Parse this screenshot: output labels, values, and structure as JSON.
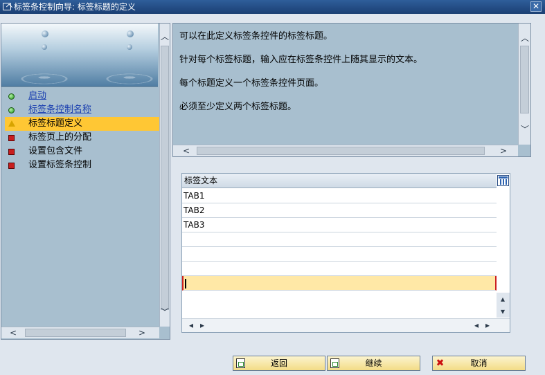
{
  "window": {
    "title": "标签条控制向导: 标签标题的定义",
    "close_glyph": "✕"
  },
  "steps": [
    {
      "label": "启动",
      "status": "done"
    },
    {
      "label": "标签条控制名称",
      "status": "done"
    },
    {
      "label": "标签标题定义",
      "status": "current"
    },
    {
      "label": "标签页上的分配",
      "status": "todo"
    },
    {
      "label": "设置包含文件",
      "status": "todo"
    },
    {
      "label": "设置标签条控制",
      "status": "todo"
    }
  ],
  "description": [
    "可以在此定义标签条控件的标签标题。",
    "针对每个标签标题，输入应在标签条控件上随其显示的文本。",
    "每个标题定义一个标签条控件页面。",
    "必须至少定义两个标签标题。"
  ],
  "table": {
    "header": "标签文本",
    "rows": [
      "TAB1",
      "TAB2",
      "TAB3",
      "",
      "",
      "",
      ""
    ]
  },
  "buttons": {
    "back": "返回",
    "continue": "继续",
    "cancel": "取消"
  },
  "icons": {
    "window": "window-icon",
    "close": "close-icon",
    "step_done": "green-light-icon",
    "step_current": "warning-triangle-icon",
    "step_todo": "red-square-icon",
    "table_config": "table-settings-icon",
    "back": "document-back-icon",
    "continue": "document-continue-icon",
    "cancel": "red-x-icon"
  },
  "colors": {
    "title_bar": "#1b3f73",
    "panel_background": "#a8bfcf",
    "current_step_highlight": "#ffc734",
    "link": "#1a3fb0",
    "button": "#f3dc86",
    "input_row": "#ffe8a6"
  }
}
